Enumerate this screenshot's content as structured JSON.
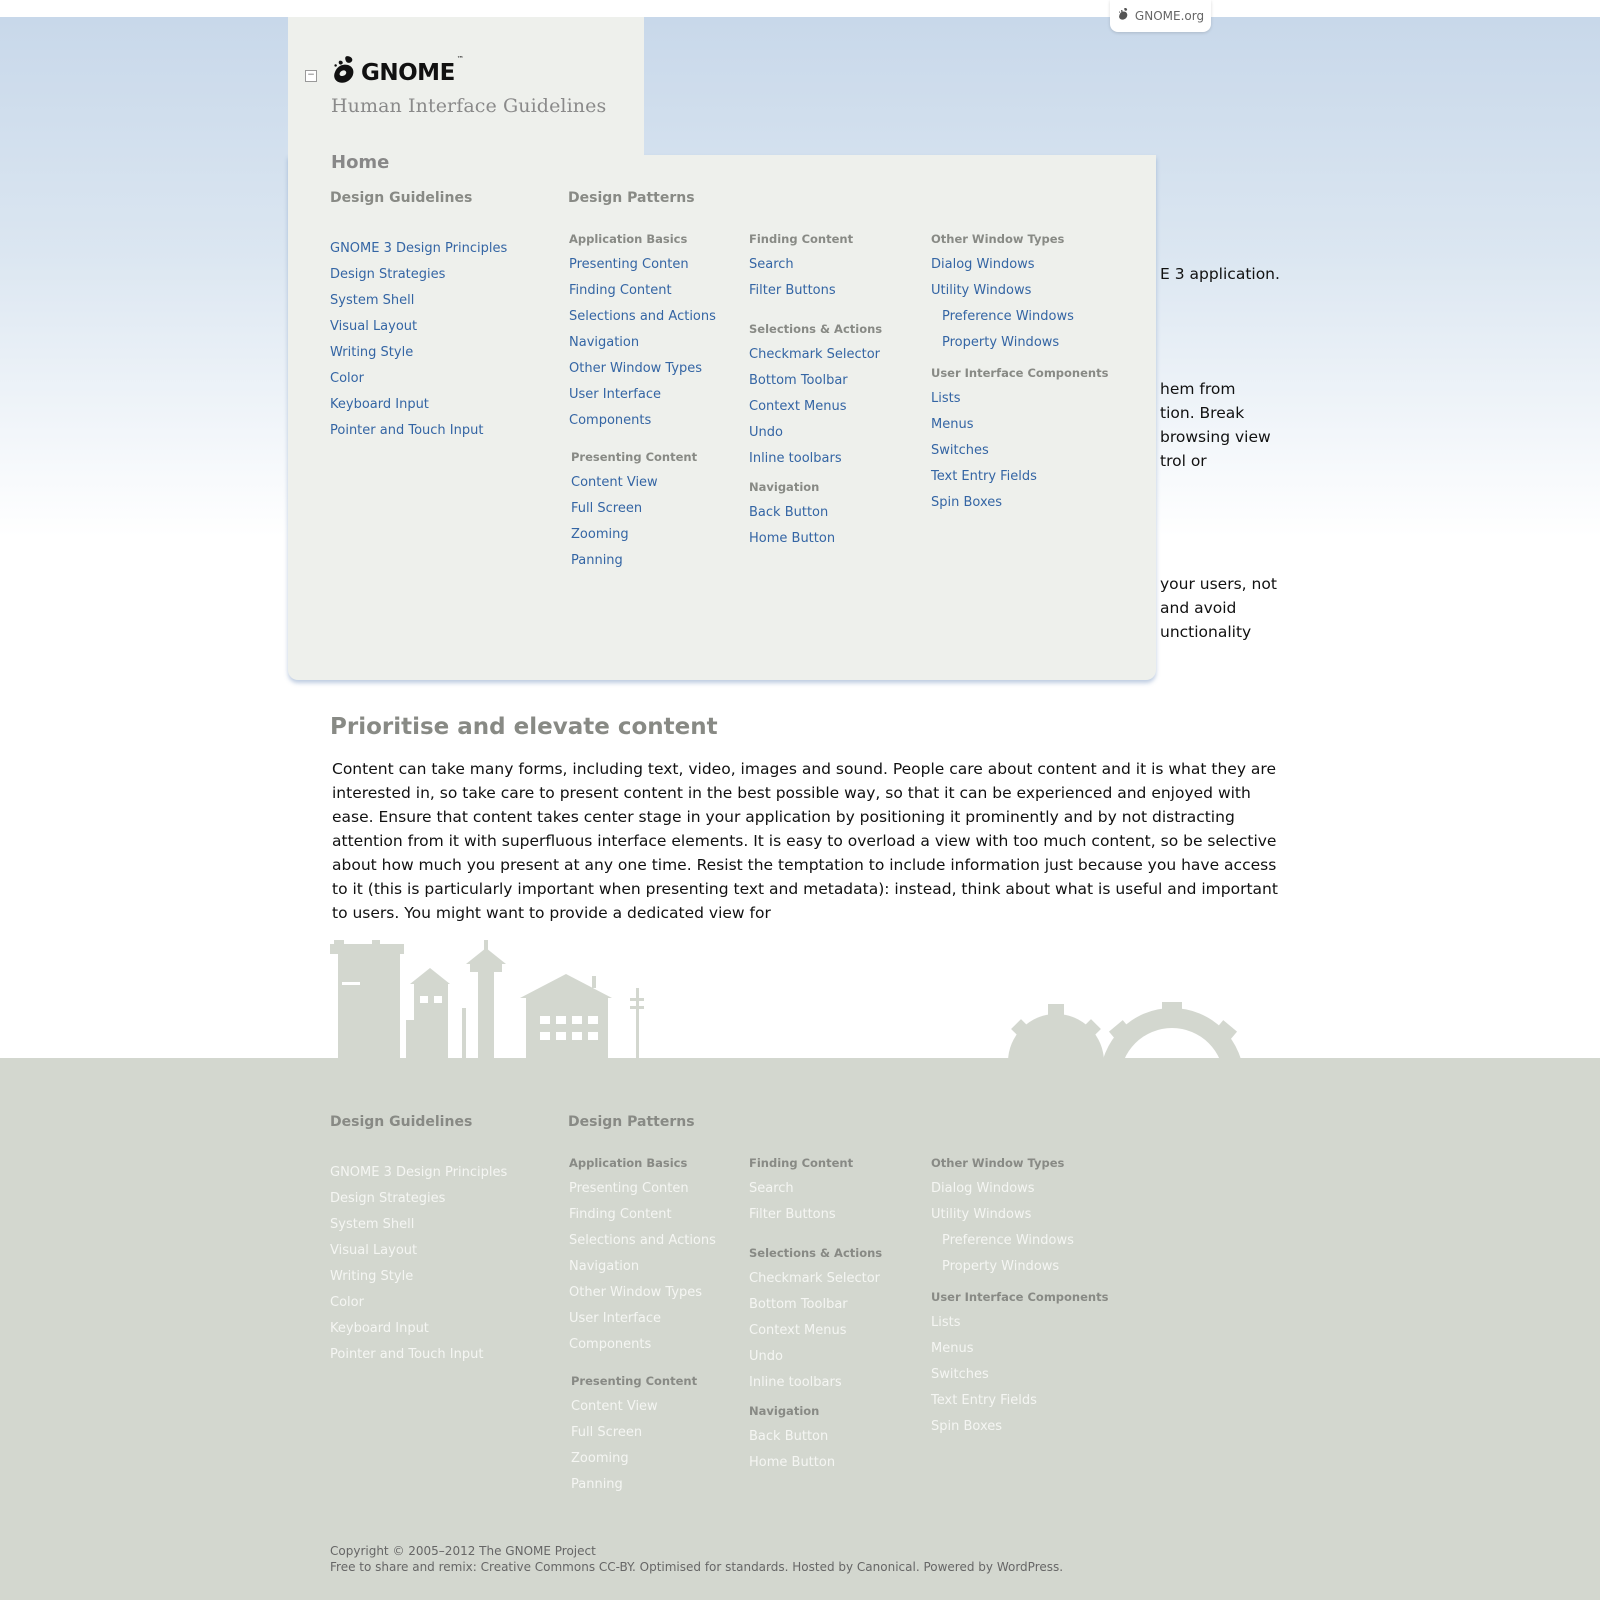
{
  "top_bar": {
    "gnome_org_label": "GNOME.org"
  },
  "header": {
    "logo_text": "GNOME",
    "logo_tm": "™",
    "subtitle": "Human Interface Guidelines",
    "collapse_symbol": "−",
    "home_label": "Home"
  },
  "menu": {
    "design_guidelines": {
      "title": "Design Guidelines",
      "items": [
        "GNOME 3 Design Principles",
        "Design Strategies",
        "System Shell",
        "Visual Layout",
        "Writing Style",
        "Color",
        "Keyboard Input",
        "Pointer and Touch Input"
      ]
    },
    "design_patterns": {
      "title": "Design Patterns",
      "application_basics": {
        "title": "Application Basics",
        "items": [
          "Presenting Conten",
          "Finding Content",
          "Selections and Actions",
          "Navigation",
          "Other Window Types",
          "User Interface",
          "Components"
        ]
      },
      "presenting_content": {
        "title": "Presenting Content",
        "items": [
          "Content View",
          "Full Screen",
          "Zooming",
          "Panning"
        ]
      },
      "finding_content": {
        "title": "Finding Content",
        "items": [
          "Search",
          "Filter Buttons"
        ]
      },
      "selections_actions": {
        "title": "Selections & Actions",
        "items": [
          "Checkmark Selector",
          "Bottom Toolbar",
          "Context Menus",
          "Undo",
          "Inline toolbars"
        ]
      },
      "navigation": {
        "title": "Navigation",
        "items": [
          "Back Button",
          "Home Button"
        ]
      },
      "other_window_types": {
        "title": "Other Window Types",
        "items": [
          "Dialog Windows",
          "Utility Windows",
          "Preference Windows",
          "Property Windows"
        ]
      },
      "ui_components": {
        "title": "User Interface Components",
        "items": [
          "Lists",
          "Menus",
          "Switches",
          "Text Entry Fields",
          "Spin Boxes"
        ]
      }
    }
  },
  "main": {
    "peek_lines": [
      "E 3 application.",
      "hem from",
      "tion. Break",
      "browsing view",
      "trol or",
      "your users, not",
      "and avoid",
      "unctionality"
    ],
    "section_title": "Prioritise and elevate content",
    "paragraph": "Content can take many forms, including text, video, images and sound. People care about content and it is what they are interested in, so take care to present content in the best possible way, so that it can be experienced and enjoyed with ease. Ensure that content takes center stage in your application by positioning it prominently and by not distracting attention from it with superfluous interface elements. It is easy to overload a view with too much content, so be selective about how much you present at any one time. Resist the temptation to include information just because you have access to it (this is particularly important when presenting text and metadata): instead, think about what is useful and important to users. You might want to provide a dedicated view for"
  },
  "footer": {
    "copyright": "Copyright © 2005–2012 The GNOME Project",
    "license": "Free to share and remix: Creative Commons CC-BY. Optimised for standards. Hosted by Canonical. Powered by WordPress."
  },
  "colors": {
    "link": "#3465a4",
    "panel": "#eef0ec",
    "footer_bg": "#d3d7cf",
    "heading_gray": "#888a85",
    "footer_link": "#f5f6f3"
  },
  "icons": [
    "gnome-foot-icon",
    "collapse-icon",
    "skyline-illustration",
    "gears-illustration"
  ]
}
